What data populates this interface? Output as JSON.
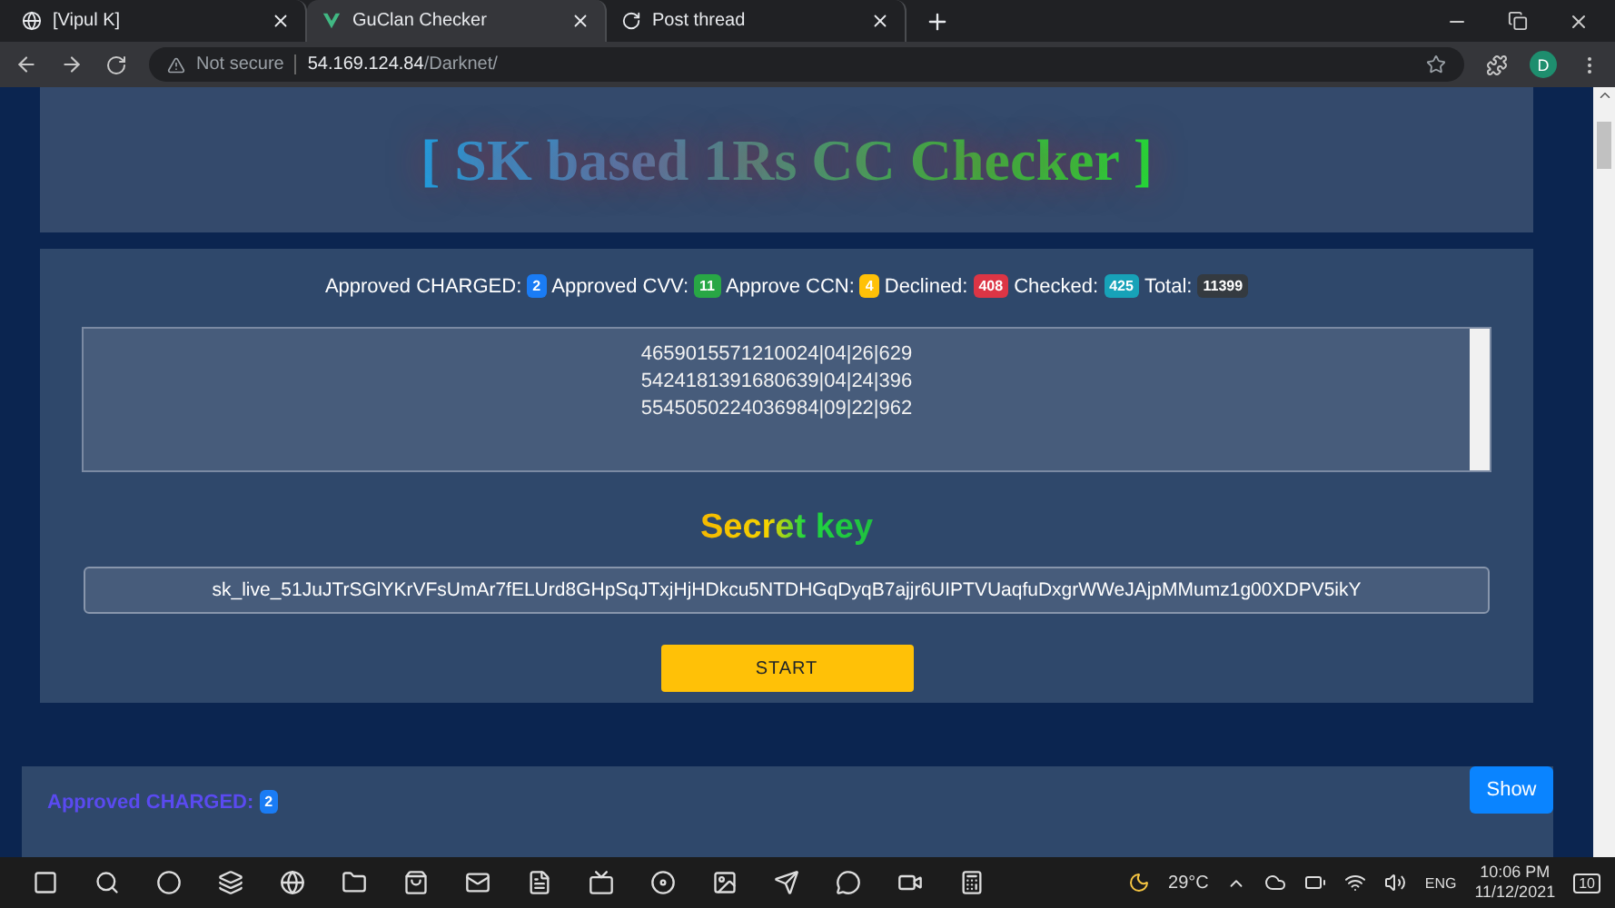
{
  "browser": {
    "tabs": [
      {
        "title": "[Vipul K]",
        "selected": false
      },
      {
        "title": "GuClan Checker",
        "selected": true
      },
      {
        "title": "Post thread",
        "selected": false
      }
    ],
    "security": "Not secure",
    "url_host": "54.169.124.84",
    "url_path": "/Darknet/",
    "profile": "D"
  },
  "header": {
    "title": "[ SK based 1Rs CC Checker ]"
  },
  "stats": [
    {
      "label": "Approved CHARGED:",
      "value": "2",
      "color": "#1a7cf5"
    },
    {
      "label": "Approved CVV:",
      "value": "11",
      "color": "#28a745"
    },
    {
      "label": "Approve CCN:",
      "value": "4",
      "color": "#ffc107"
    },
    {
      "label": "Declined:",
      "value": "408",
      "color": "#dc3545"
    },
    {
      "label": "Checked:",
      "value": "425",
      "color": "#17a2b8"
    },
    {
      "label": "Total:",
      "value": "11399",
      "color": "#343a40"
    }
  ],
  "cards": [
    "4659015571210024|04|26|629",
    "5424181391680639|04|24|396",
    "5545050224036984|09|22|962"
  ],
  "secret_key": {
    "label": "Secret key",
    "value": "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"
  },
  "start_button": "START",
  "approved_panel": {
    "label": "Approved CHARGED:",
    "value": "2",
    "button": "Show"
  },
  "taskbar": {
    "temperature": "29°C",
    "language": "ENG",
    "time": "10:06 PM",
    "date": "11/12/2021",
    "notifications": "10"
  }
}
